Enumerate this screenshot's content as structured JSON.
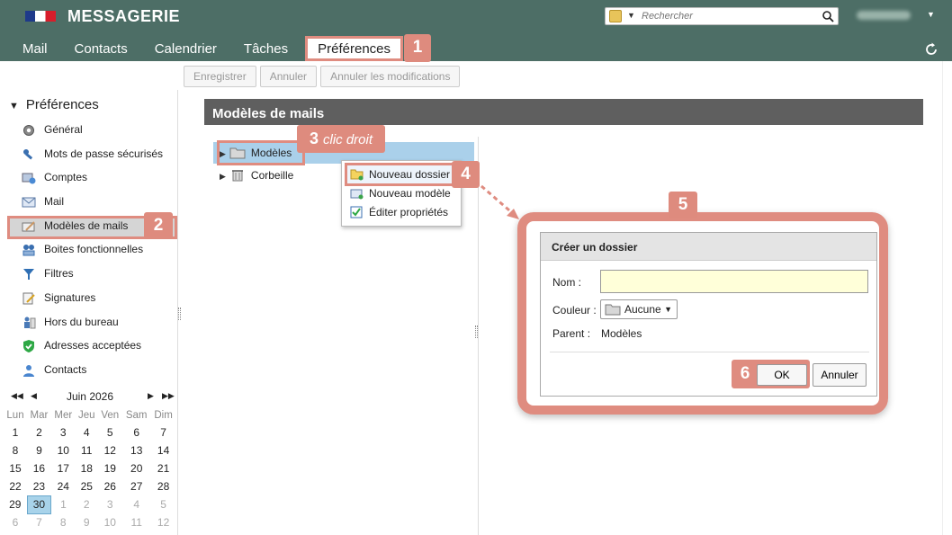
{
  "header": {
    "app_title": "MESSAGERIE",
    "search_placeholder": "Rechercher",
    "nav_tabs": [
      "Mail",
      "Contacts",
      "Calendrier",
      "Tâches",
      "Préférences"
    ]
  },
  "toolbar": {
    "save_label": "Enregistrer",
    "cancel_label": "Annuler",
    "cancel_changes_label": "Annuler les modifications"
  },
  "sidebar": {
    "title": "Préférences",
    "items": [
      {
        "label": "Général",
        "icon": "gear-icon"
      },
      {
        "label": "Mots de passe sécurisés",
        "icon": "key-icon"
      },
      {
        "label": "Comptes",
        "icon": "accounts-icon"
      },
      {
        "label": "Mail",
        "icon": "envelope-icon"
      },
      {
        "label": "Modèles de mails",
        "icon": "template-icon"
      },
      {
        "label": "Boites fonctionnelles",
        "icon": "functional-box-icon"
      },
      {
        "label": "Filtres",
        "icon": "filter-icon"
      },
      {
        "label": "Signatures",
        "icon": "signature-icon"
      },
      {
        "label": "Hors du bureau",
        "icon": "out-of-office-icon"
      },
      {
        "label": "Adresses acceptées",
        "icon": "shield-check-icon"
      },
      {
        "label": "Contacts",
        "icon": "contact-icon"
      }
    ]
  },
  "calendar": {
    "month_label": "Juin 2026",
    "weekdays": [
      "Lun",
      "Mar",
      "Mer",
      "Jeu",
      "Ven",
      "Sam",
      "Dim"
    ],
    "weeks": [
      [
        "1",
        "2",
        "3",
        "4",
        "5",
        "6",
        "7"
      ],
      [
        "8",
        "9",
        "10",
        "11",
        "12",
        "13",
        "14"
      ],
      [
        "15",
        "16",
        "17",
        "18",
        "19",
        "20",
        "21"
      ],
      [
        "22",
        "23",
        "24",
        "25",
        "26",
        "27",
        "28"
      ],
      [
        "29",
        "30",
        "1",
        "2",
        "3",
        "4",
        "5"
      ],
      [
        "6",
        "7",
        "8",
        "9",
        "10",
        "11",
        "12"
      ]
    ],
    "today": "30"
  },
  "main": {
    "section_title": "Modèles de mails",
    "tree": [
      {
        "label": "Modèles"
      },
      {
        "label": "Corbeille"
      }
    ],
    "context_menu": [
      "Nouveau dossier",
      "Nouveau modèle",
      "Éditer propriétés"
    ],
    "annotation_right_click": "clic droit"
  },
  "dialog": {
    "title": "Créer un dossier",
    "name_label": "Nom :",
    "color_label": "Couleur :",
    "color_value": "Aucune",
    "parent_label": "Parent :",
    "parent_value": "Modèles",
    "ok_label": "OK",
    "cancel_label": "Annuler"
  },
  "badges": [
    "1",
    "2",
    "3",
    "4",
    "5",
    "6"
  ],
  "colors": {
    "header_bg": "#4d6e66",
    "highlight": "#df8c80",
    "section_header": "#5f5f5f",
    "tree_selection": "#aad0ea"
  }
}
